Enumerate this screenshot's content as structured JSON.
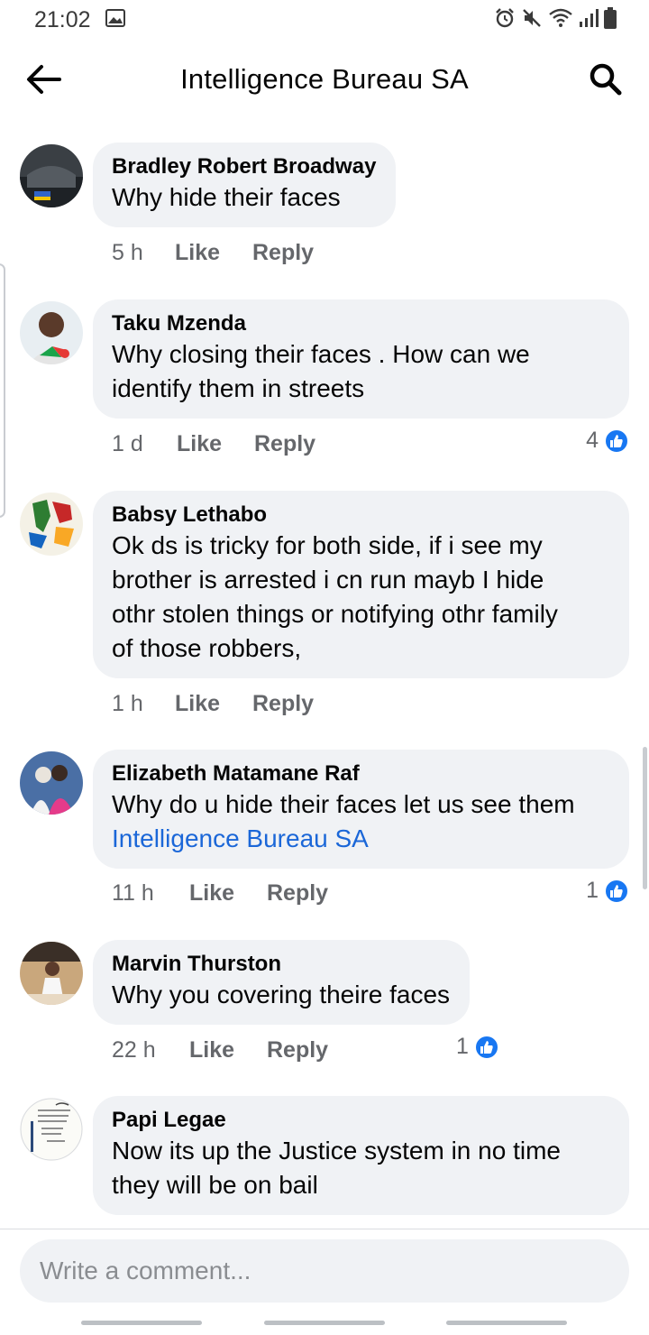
{
  "status_bar": {
    "time": "21:02",
    "icons": [
      "gallery-icon",
      "alarm-icon",
      "mute-icon",
      "wifi-icon",
      "signal-icon",
      "battery-icon"
    ]
  },
  "header": {
    "title": "Intelligence Bureau SA",
    "back_icon": "back-arrow-icon",
    "search_icon": "search-icon"
  },
  "actions": {
    "like": "Like",
    "reply": "Reply"
  },
  "comments": [
    {
      "author": "Bradley Robert Broadway",
      "lines": [
        "Why hide their faces"
      ],
      "time": "5 h"
    },
    {
      "author": "Taku Mzenda",
      "lines": [
        "Why closing their faces . How can we",
        "identify them in streets"
      ],
      "time": "1 d",
      "reactions": "4"
    },
    {
      "author": "Babsy Lethabo",
      "lines": [
        "Ok ds is tricky for both side, if i see my",
        "brother is arrested i cn run mayb I hide",
        "othr stolen things or notifying othr family",
        "of those robbers,"
      ],
      "time": "1 h"
    },
    {
      "author": "Elizabeth Matamane Raf",
      "lines": [
        "Why do u hide their faces let us see them"
      ],
      "mention": "Intelligence Bureau SA",
      "time": "11 h",
      "reactions": "1"
    },
    {
      "author": "Marvin Thurston",
      "lines": [
        "Why you covering theire faces"
      ],
      "time": "22 h",
      "reactions": "1"
    },
    {
      "author": "Papi Legae",
      "lines": [
        "Now its up the Justice system  in no time",
        "they will be on bail"
      ]
    }
  ],
  "composer": {
    "placeholder": "Write a comment..."
  },
  "colors": {
    "accent": "#1877f2",
    "mention": "#1b67d8",
    "bubble": "#f0f2f5",
    "meta": "#65676b"
  }
}
